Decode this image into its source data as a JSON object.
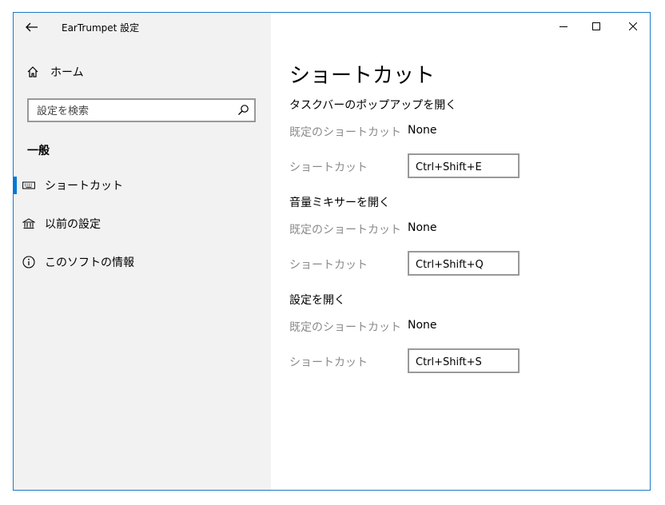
{
  "window": {
    "title": "EarTrumpet 設定"
  },
  "sidebar": {
    "home_label": "ホーム",
    "search": {
      "placeholder": "設定を検索",
      "value": ""
    },
    "section_title": "一般",
    "items": [
      {
        "label": "ショートカット",
        "icon": "keyboard-icon",
        "selected": true
      },
      {
        "label": "以前の設定",
        "icon": "bank-icon",
        "selected": false
      },
      {
        "label": "このソフトの情報",
        "icon": "info-icon",
        "selected": false
      }
    ]
  },
  "main": {
    "title": "ショートカット",
    "groups": [
      {
        "title": "タスクバーのポップアップを開く",
        "default_label": "既定のショートカット",
        "default_value": "None",
        "shortcut_label": "ショートカット",
        "shortcut_value": "Ctrl+Shift+E"
      },
      {
        "title": "音量ミキサーを開く",
        "default_label": "既定のショートカット",
        "default_value": "None",
        "shortcut_label": "ショートカット",
        "shortcut_value": "Ctrl+Shift+Q"
      },
      {
        "title": "設定を開く",
        "default_label": "既定のショートカット",
        "default_value": "None",
        "shortcut_label": "ショートカット",
        "shortcut_value": "Ctrl+Shift+S"
      }
    ]
  },
  "colors": {
    "accent": "#0078d7",
    "window_border": "#1f78c8",
    "sidebar_bg": "#f2f2f2",
    "muted_text": "#8a8a8a"
  }
}
